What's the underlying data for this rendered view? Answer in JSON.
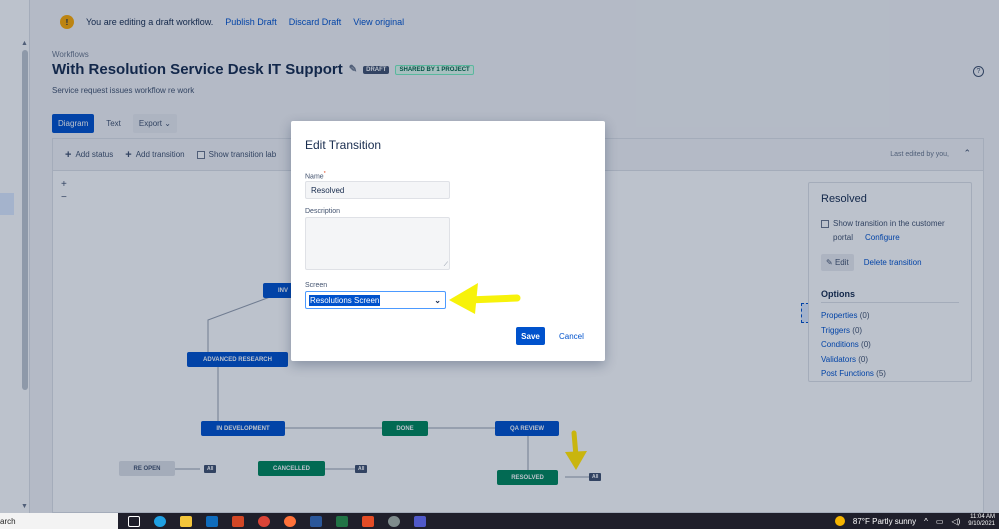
{
  "banner": {
    "message": "You are editing a draft workflow.",
    "publish": "Publish Draft",
    "discard": "Discard Draft",
    "view_original": "View original"
  },
  "header": {
    "breadcrumb": "Workflows",
    "title": "With Resolution Service Desk IT Support",
    "draft_badge": "DRAFT",
    "shared_badge": "SHARED BY 1 PROJECT",
    "description": "Service request issues workflow re work",
    "help": "?"
  },
  "tabs": {
    "diagram": "Diagram",
    "text": "Text",
    "export": "Export"
  },
  "toolbar": {
    "add_status": "Add status",
    "add_transition": "Add transition",
    "show_labels": "Show transition lab",
    "last_edited": "Last edited by you,"
  },
  "zoom": {
    "in": "+",
    "out": "−"
  },
  "diagram": {
    "nodes": {
      "inv": "INV",
      "advanced_research": "ADVANCED RESEARCH",
      "in_development": "IN DEVELOPMENT",
      "done": "DONE",
      "qa_review": "QA REVIEW",
      "re_open": "RE OPEN",
      "cancelled": "CANCELLED",
      "resolved": "RESOLVED"
    },
    "all_label": "All"
  },
  "panel": {
    "title": "Resolved",
    "show_customer": "Show transition in the customer",
    "portal": "portal",
    "configure": "Configure",
    "edit": "Edit",
    "delete": "Delete transition",
    "options_title": "Options",
    "options": [
      {
        "label": "Properties",
        "count": "(0)"
      },
      {
        "label": "Triggers",
        "count": "(0)"
      },
      {
        "label": "Conditions",
        "count": "(0)"
      },
      {
        "label": "Validators",
        "count": "(0)"
      },
      {
        "label": "Post Functions",
        "count": "(5)"
      }
    ]
  },
  "modal": {
    "title": "Edit Transition",
    "name_label": "Name",
    "required": "*",
    "name_value": "Resolved",
    "description_label": "Description",
    "screen_label": "Screen",
    "screen_value": "Resolutions Screen",
    "save": "Save",
    "cancel": "Cancel"
  },
  "taskbar": {
    "search_text": "arch",
    "weather": "87°F  Partly sunny",
    "time": "11:04 AM",
    "date": "9/10/2021"
  },
  "colors": {
    "accent": "#0052cc",
    "status_green": "#00875a",
    "annotation": "#f7f20a"
  }
}
